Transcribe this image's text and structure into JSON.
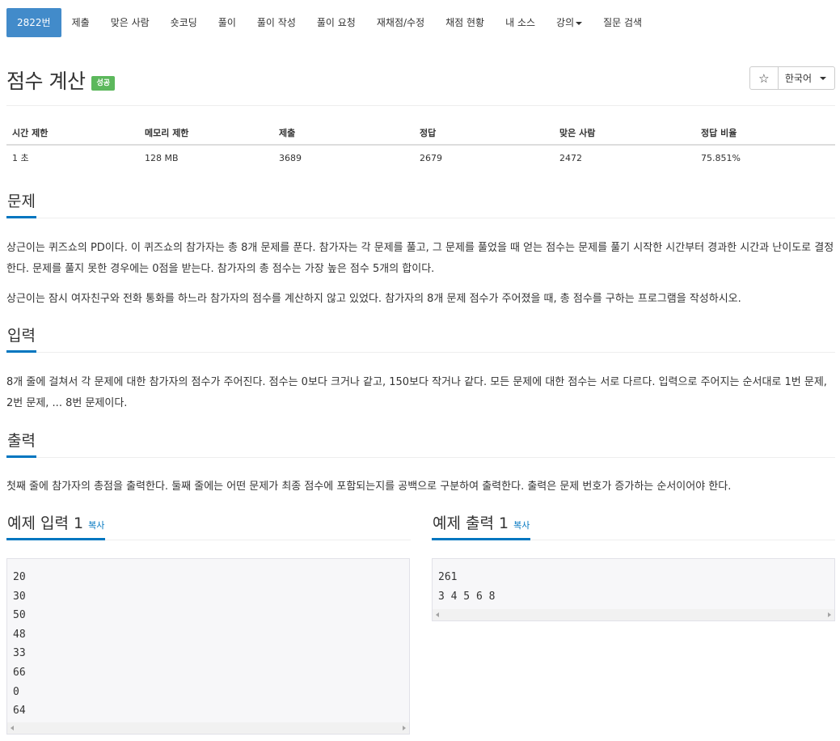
{
  "nav": {
    "items": [
      {
        "label": "2822번",
        "active": true
      },
      {
        "label": "제출"
      },
      {
        "label": "맞은 사람"
      },
      {
        "label": "숏코딩"
      },
      {
        "label": "풀이"
      },
      {
        "label": "풀이 작성"
      },
      {
        "label": "풀이 요청"
      },
      {
        "label": "재채점/수정"
      },
      {
        "label": "채점 현황"
      },
      {
        "label": "내 소스"
      },
      {
        "label": "강의",
        "dropdown": true
      },
      {
        "label": "질문 검색"
      }
    ]
  },
  "problem": {
    "title": "점수 계산",
    "status_badge": "성공",
    "star_icon": "☆",
    "language": "한국어"
  },
  "info": {
    "headers": [
      "시간 제한",
      "메모리 제한",
      "제출",
      "정답",
      "맞은 사람",
      "정답 비율"
    ],
    "values": [
      "1 초",
      "128 MB",
      "3689",
      "2679",
      "2472",
      "75.851%"
    ]
  },
  "sections": {
    "problem_heading": "문제",
    "problem_p1": "상근이는 퀴즈쇼의 PD이다. 이 퀴즈쇼의 참가자는 총 8개 문제를 푼다. 참가자는 각 문제를 풀고, 그 문제를 풀었을 때 얻는 점수는 문제를 풀기 시작한 시간부터 경과한 시간과 난이도로 결정한다. 문제를 풀지 못한 경우에는 0점을 받는다. 참가자의 총 점수는 가장 높은 점수 5개의 합이다.",
    "problem_p2": "상근이는 잠시 여자친구와 전화 통화를 하느라 참가자의 점수를 계산하지 않고 있었다. 참가자의 8개 문제 점수가 주어졌을 때, 총 점수를 구하는 프로그램을 작성하시오.",
    "input_heading": "입력",
    "input_p": "8개 줄에 걸쳐서 각 문제에 대한 참가자의 점수가 주어진다. 점수는 0보다 크거나 같고, 150보다 작거나 같다. 모든 문제에 대한 점수는 서로 다르다. 입력으로 주어지는 순서대로 1번 문제, 2번 문제, ... 8번 문제이다.",
    "output_heading": "출력",
    "output_p": "첫째 줄에 참가자의 총점을 출력한다. 둘째 줄에는 어떤 문제가 최종 점수에 포함되는지를 공백으로 구분하여 출력한다. 출력은 문제 번호가 증가하는 순서이어야 한다."
  },
  "samples": {
    "input_heading": "예제 입력 1",
    "output_heading": "예제 출력 1",
    "copy_label": "복사",
    "input_text": "20\n30\n50\n48\n33\n66\n0\n64",
    "output_text": "261\n3 4 5 6 8"
  },
  "colors": {
    "accent": "#428bca",
    "link": "#0076c0",
    "success": "#5cb85c"
  }
}
